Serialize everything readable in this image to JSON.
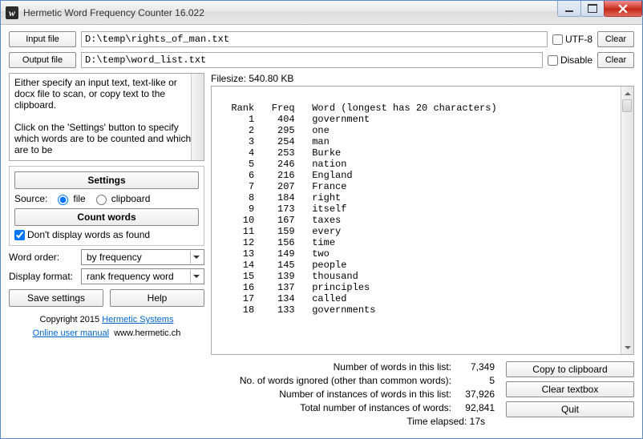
{
  "window": {
    "title": "Hermetic Word Frequency Counter 16.022"
  },
  "toolbar": {
    "input_btn": "Input file",
    "output_btn": "Output file",
    "input_path": "D:\\temp\\rights_of_man.txt",
    "output_path": "D:\\temp\\word_list.txt",
    "utf8_label": "UTF-8",
    "disable_label": "Disable",
    "clear_label": "Clear"
  },
  "info_text": "Either specify an input text, text-like or docx file to scan, or copy text to the clipboard.\n\nClick on the 'Settings' button to specify which words are to be counted and which are to be",
  "settings": {
    "settings_btn": "Settings",
    "source_label": "Source:",
    "file_label": "file",
    "clipboard_label": "clipboard",
    "source_selected": "file",
    "count_btn": "Count words",
    "dont_display_label": "Don't display words as found",
    "dont_display_checked": true,
    "word_order_label": "Word order:",
    "word_order_value": "by frequency",
    "display_format_label": "Display format:",
    "display_format_value": "rank frequency word",
    "save_btn": "Save settings",
    "help_btn": "Help"
  },
  "credits": {
    "copyright": "Copyright 2015",
    "company": "Hermetic Systems",
    "manual": "Online user manual",
    "site": "www.hermetic.ch"
  },
  "filesize": {
    "label": "Filesize:",
    "value": "540.80 KB"
  },
  "results": {
    "header": {
      "rank": "Rank",
      "freq": "Freq",
      "word": "Word (longest has 20 characters)"
    },
    "rows": [
      {
        "rank": 1,
        "freq": 404,
        "word": "government"
      },
      {
        "rank": 2,
        "freq": 295,
        "word": "one"
      },
      {
        "rank": 3,
        "freq": 254,
        "word": "man"
      },
      {
        "rank": 4,
        "freq": 253,
        "word": "Burke"
      },
      {
        "rank": 5,
        "freq": 246,
        "word": "nation"
      },
      {
        "rank": 6,
        "freq": 216,
        "word": "England"
      },
      {
        "rank": 7,
        "freq": 207,
        "word": "France"
      },
      {
        "rank": 8,
        "freq": 184,
        "word": "right"
      },
      {
        "rank": 9,
        "freq": 173,
        "word": "itself"
      },
      {
        "rank": 10,
        "freq": 167,
        "word": "taxes"
      },
      {
        "rank": 11,
        "freq": 159,
        "word": "every"
      },
      {
        "rank": 12,
        "freq": 156,
        "word": "time"
      },
      {
        "rank": 13,
        "freq": 149,
        "word": "two"
      },
      {
        "rank": 14,
        "freq": 145,
        "word": "people"
      },
      {
        "rank": 15,
        "freq": 139,
        "word": "thousand"
      },
      {
        "rank": 16,
        "freq": 137,
        "word": "principles"
      },
      {
        "rank": 17,
        "freq": 134,
        "word": "called"
      },
      {
        "rank": 18,
        "freq": 133,
        "word": "governments"
      }
    ]
  },
  "stats": {
    "num_words_label": "Number of words in this list:",
    "num_words": "7,349",
    "ignored_label": "No. of words ignored (other than common words):",
    "ignored": "5",
    "instances_list_label": "Number of instances of words in this list:",
    "instances_list": "37,926",
    "instances_total_label": "Total number of instances of words:",
    "instances_total": "92,841",
    "elapsed_label": "Time elapsed:",
    "elapsed": "17s"
  },
  "buttons_right": {
    "copy": "Copy to clipboard",
    "clear": "Clear textbox",
    "quit": "Quit"
  }
}
